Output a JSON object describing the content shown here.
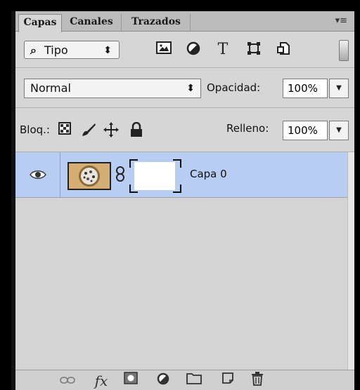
{
  "tabs": [
    {
      "label": "Capas",
      "active": true
    },
    {
      "label": "Canales",
      "active": false
    },
    {
      "label": "Trazados",
      "active": false
    }
  ],
  "panel_menu_icon": "panel-menu-icon",
  "filter": {
    "search_glyph": "⌕",
    "kind_label": "Tipo",
    "arrows": "⬍",
    "icons": [
      "image-filter-icon",
      "adjustment-filter-icon",
      "type-filter-icon",
      "shape-filter-icon",
      "smart-object-filter-icon"
    ]
  },
  "blend": {
    "mode": "Normal",
    "arrows": "⬍",
    "opacity_label": "Opacidad:",
    "opacity_value": "100%"
  },
  "lock": {
    "label": "Bloq.:",
    "icons": [
      "lock-transparent-pixels-icon",
      "lock-image-pixels-icon",
      "lock-position-icon",
      "lock-all-icon"
    ],
    "fill_label": "Relleno:",
    "fill_value": "100%"
  },
  "layers": [
    {
      "name": "Capa 0",
      "visible": true,
      "selected": true
    }
  ],
  "bottom_icons": [
    "link-layers-icon",
    "fx-icon",
    "add-mask-icon",
    "new-adjustment-icon",
    "new-group-icon",
    "new-layer-icon",
    "trash-icon"
  ],
  "colors": {
    "selected_row": "#b7cdf1",
    "panel_bg": "#d6d6d6"
  }
}
